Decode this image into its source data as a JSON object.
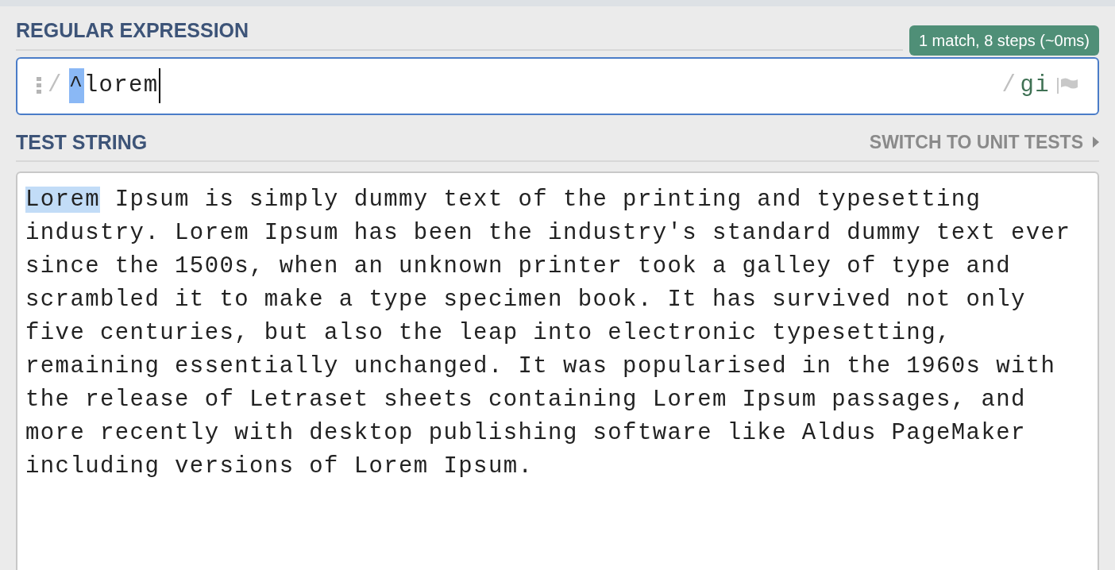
{
  "regex_section": {
    "title": "REGULAR EXPRESSION",
    "match_info": "1 match, 8 steps (~0ms)",
    "delimiter_open": "/",
    "pattern_highlight": "^",
    "pattern_rest": "lorem",
    "delimiter_close": "/",
    "flags": "gi"
  },
  "test_section": {
    "title": "TEST STRING",
    "switch_link": "SWITCH TO UNIT TESTS",
    "match": "Lorem",
    "lines": [
      " Ipsum is simply dummy text of the printing and typesetting",
      "industry. Lorem Ipsum has been the industry's standard dummy text ever",
      "since the 1500s, when an unknown printer took a galley of type and",
      "scrambled it to make a type specimen book. It has survived not only",
      "five centuries, but also the leap into electronic typesetting,",
      "remaining essentially unchanged. It was popularised in the 1960s with",
      "the release of Letraset sheets containing Lorem Ipsum passages, and",
      "more recently with desktop publishing software like Aldus PageMaker",
      "including versions of Lorem Ipsum."
    ]
  }
}
